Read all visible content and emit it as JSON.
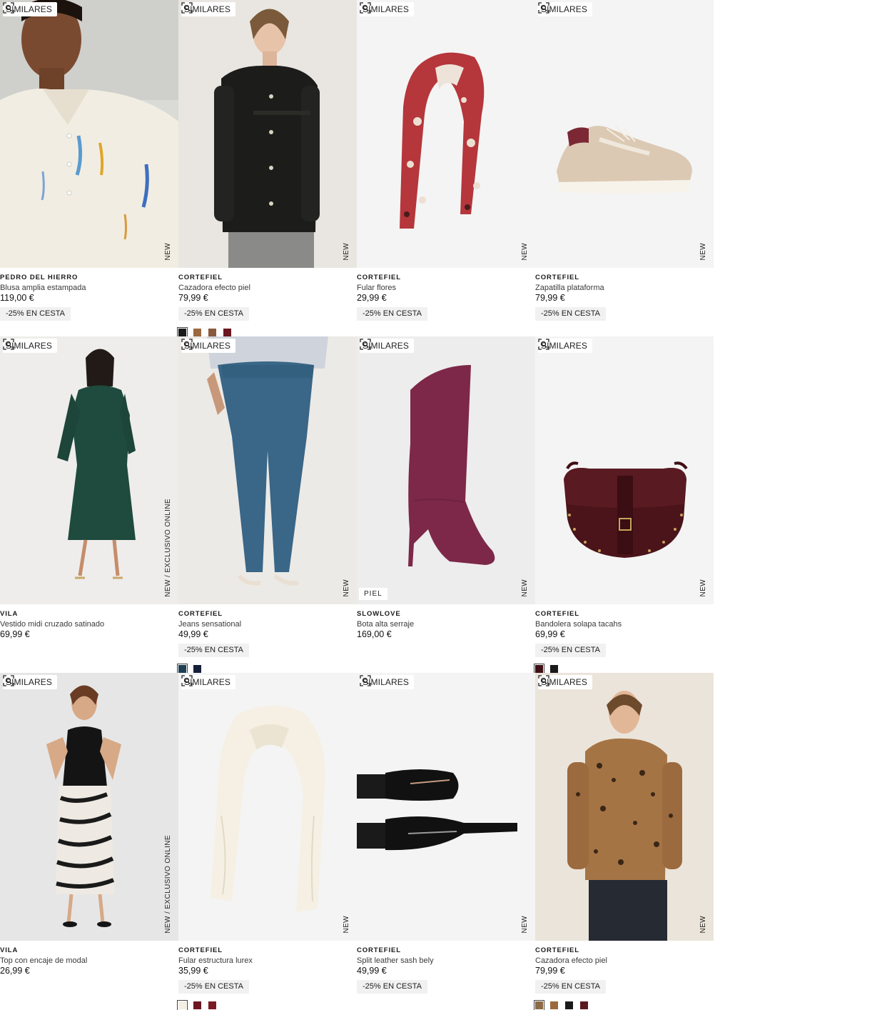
{
  "labels": {
    "similar": "SIMILARES",
    "new": "NEW",
    "new_exclusive": "NEW  /  EXCLUSIVO ONLINE",
    "leather": "PIEL"
  },
  "products": [
    {
      "brand": "PEDRO DEL HIERRO",
      "name": "Blusa amplia estampada",
      "price": "119,00 €",
      "promo": "-25% EN CESTA",
      "swatches": [],
      "image": "white-printed-blouse-model"
    },
    {
      "brand": "CORTEFIEL",
      "name": "Cazadora efecto piel",
      "price": "79,99 €",
      "promo": "-25% EN CESTA",
      "swatches": [
        "#1a1a1a",
        "#9a6a3e",
        "#8a5a3e",
        "#6b1620"
      ],
      "image": "black-suede-jacket-model"
    },
    {
      "brand": "CORTEFIEL",
      "name": "Fular flores",
      "price": "29,99 €",
      "promo": "-25% EN CESTA",
      "swatches": [],
      "image": "red-floral-scarf"
    },
    {
      "brand": "CORTEFIEL",
      "name": "Zapatilla plataforma",
      "price": "79,99 €",
      "promo": "-25% EN CESTA",
      "swatches": [],
      "image": "beige-platform-sneaker"
    },
    {
      "brand": "VILA",
      "name": "Vestido midi cruzado satinado",
      "price": "69,99 €",
      "promo": "",
      "swatches": [],
      "image": "green-satin-wrap-dress-model",
      "exclusive": true
    },
    {
      "brand": "CORTEFIEL",
      "name": "Jeans sensational",
      "price": "49,99 €",
      "promo": "-25% EN CESTA",
      "swatches": [
        "#1f3f55",
        "#16203a"
      ],
      "image": "blue-skinny-jeans-model"
    },
    {
      "brand": "SLOWLOVE",
      "name": "Bota alta serraje",
      "price": "169,00 €",
      "promo": "",
      "swatches": [],
      "image": "burgundy-suede-knee-boot",
      "leather": true
    },
    {
      "brand": "CORTEFIEL",
      "name": "Bandolera solapa tacahs",
      "price": "69,99 €",
      "promo": "-25% EN CESTA",
      "swatches": [
        "#3e0f14",
        "#1a1a1a"
      ],
      "image": "burgundy-studded-crossbody-bag"
    },
    {
      "brand": "VILA",
      "name": "Top con encaje de modal",
      "price": "26,99 €",
      "promo": "",
      "swatches": [],
      "image": "black-lace-top-zebra-skirt-model",
      "exclusive": true
    },
    {
      "brand": "CORTEFIEL",
      "name": "Fular estructura lurex",
      "price": "35,99 €",
      "promo": "-25% EN CESTA",
      "swatches": [
        "#f3efe2",
        "#6b1620",
        "#7a1a24"
      ],
      "image": "cream-lurex-scarf"
    },
    {
      "brand": "CORTEFIEL",
      "name": "Split leather sash bely",
      "price": "49,99 €",
      "promo": "-25% EN CESTA",
      "swatches": [],
      "image": "black-sash-belts"
    },
    {
      "brand": "CORTEFIEL",
      "name": "Cazadora efecto piel",
      "price": "79,99 €",
      "promo": "-25% EN CESTA",
      "swatches": [
        "#8b6a45",
        "#9a6a3e",
        "#1a1a1a",
        "#5a1a20"
      ],
      "image": "leopard-print-jacket-model"
    }
  ]
}
